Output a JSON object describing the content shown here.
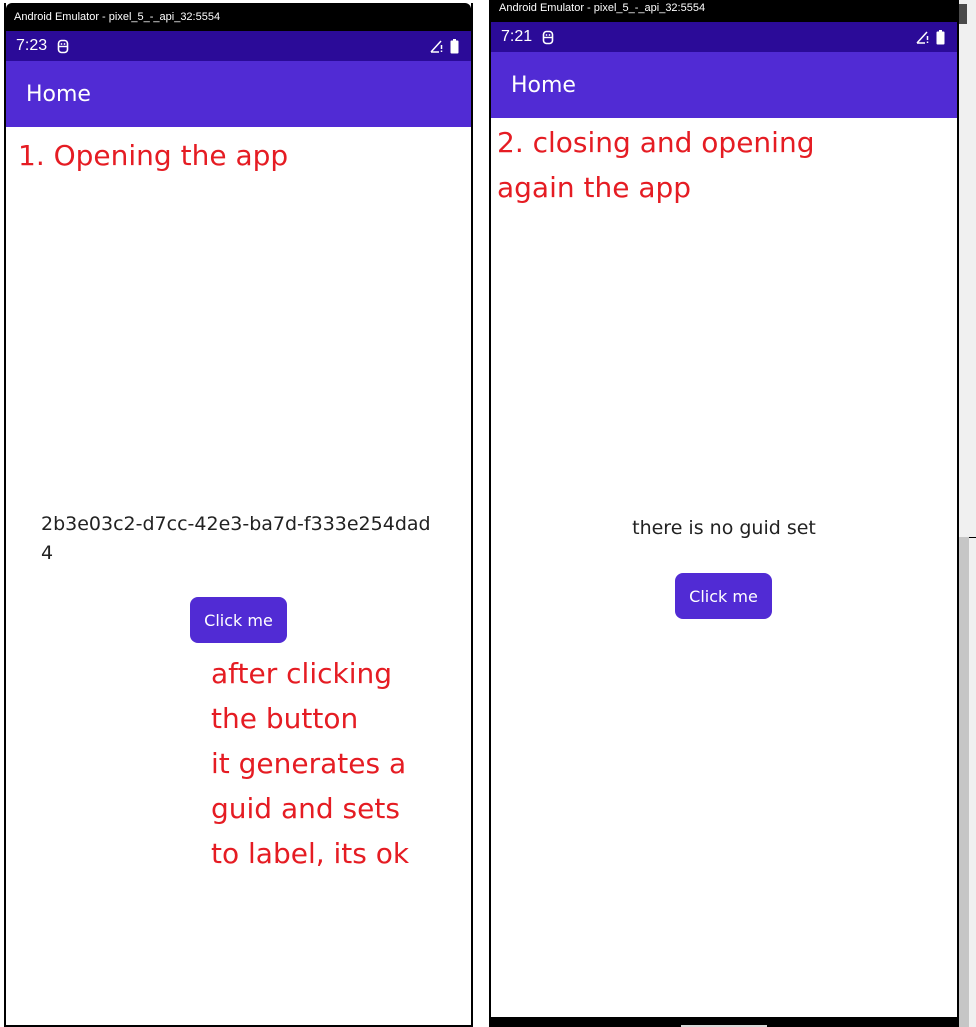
{
  "screens": [
    {
      "window_title": "Android Emulator - pixel_5_-_api_32:5554",
      "status": {
        "time": "7:23",
        "notification_icon": "sim-card-icon",
        "signal_icon": "signal-no-data-icon",
        "battery_icon": "battery-full-icon"
      },
      "appbar_title": "Home",
      "annotation_title": "1. Opening the app",
      "label_text": "2b3e03c2-d7cc-42e3-ba7d-f333e254dad4",
      "label_lines": [
        "2b3e03c2-d7cc-42e3-ba7d-f333e254dad",
        "4"
      ],
      "button_label": "Click me",
      "annotation_note_lines": [
        "after clicking",
        "the button",
        "it generates a",
        "guid and sets",
        "to label, its ok"
      ]
    },
    {
      "window_title": "Android Emulator - pixel_5_-_api_32:5554",
      "status": {
        "time": "7:21",
        "notification_icon": "sim-card-icon",
        "signal_icon": "signal-no-data-icon",
        "battery_icon": "battery-full-icon"
      },
      "appbar_title": "Home",
      "annotation_title_lines": [
        "2. closing and opening",
        "again the app"
      ],
      "label_text": "there is no guid set",
      "button_label": "Click me"
    }
  ],
  "colors": {
    "primary": "#512bd4",
    "status_bar": "#2b0b98",
    "annotation": "#e51c23",
    "label_text": "#222222"
  }
}
